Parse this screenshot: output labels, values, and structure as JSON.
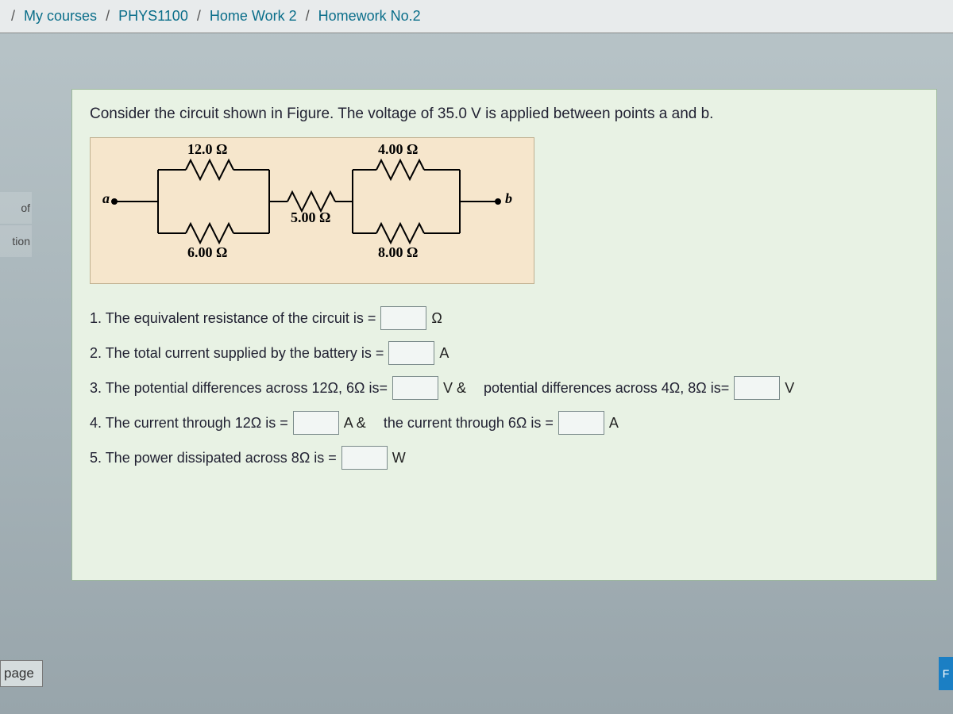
{
  "breadcrumb": {
    "items": [
      "My courses",
      "PHYS1100",
      "Home Work 2",
      "Homework No.2"
    ]
  },
  "sidebar": {
    "of": "of",
    "tion": "tion"
  },
  "prompt": "Consider the circuit shown in Figure. The voltage of 35.0 V is applied between points a and b.",
  "circuit": {
    "r1": "12.0 Ω",
    "r2": "4.00 Ω",
    "r3": "5.00 Ω",
    "r4": "6.00 Ω",
    "r5": "8.00 Ω",
    "a": "a",
    "b": "b"
  },
  "questions": {
    "q1": {
      "text": "1. The equivalent resistance of the circuit is =",
      "unit": "Ω"
    },
    "q2": {
      "text": "2. The total current supplied by the battery is =",
      "unit": "A"
    },
    "q3": {
      "textA": "3. The potential differences across 12Ω, 6Ω is=",
      "unitA": "V  &",
      "textB": "potential differences across 4Ω, 8Ω is=",
      "unitB": "V"
    },
    "q4": {
      "textA": "4. The current through 12Ω is =",
      "unitA": "A  &",
      "textB": "the current through 6Ω is =",
      "unitB": "A"
    },
    "q5": {
      "text": "5. The power dissipated across 8Ω is =",
      "unit": "W"
    }
  },
  "buttons": {
    "page": "page",
    "blue": "F"
  }
}
